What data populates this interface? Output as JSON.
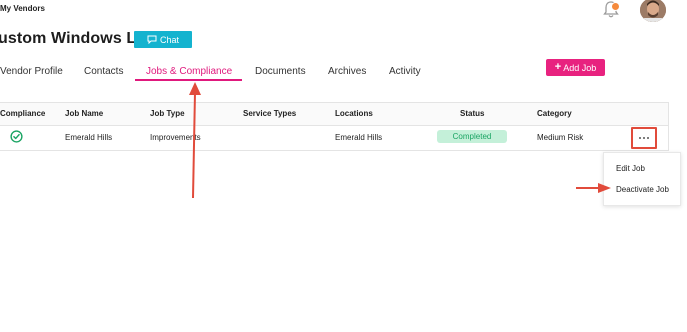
{
  "nav": {
    "back_label": "My Vendors"
  },
  "header": {
    "vendor_title": "ustom Windows LLC",
    "chat_label": "Chat"
  },
  "tabs": [
    {
      "label": "Vendor Profile"
    },
    {
      "label": "Contacts"
    },
    {
      "label": "Jobs & Compliance",
      "active": true
    },
    {
      "label": "Documents"
    },
    {
      "label": "Archives"
    },
    {
      "label": "Activity"
    }
  ],
  "add_job_label": "Add Job",
  "table": {
    "columns": [
      "Compliance",
      "Job Name",
      "Job Type",
      "Service Types",
      "Locations",
      "Status",
      "Category"
    ],
    "rows": [
      {
        "compliance": "check-circle-icon",
        "job_name": "Emerald Hills",
        "job_type": "Improvements",
        "service_types": "",
        "locations": "Emerald Hills",
        "status": "Completed",
        "category": "Medium Risk"
      }
    ]
  },
  "row_menu": {
    "items": [
      "Edit Job",
      "Deactivate Job"
    ]
  },
  "colors": {
    "accent_pink": "#e8227f",
    "chat_blue": "#14b3cf",
    "status_green": "#1aa463",
    "annotation_red": "#e14b3b"
  },
  "annotations": [
    "red-arrow-to-tab",
    "red-arrow-to-deactivate"
  ]
}
